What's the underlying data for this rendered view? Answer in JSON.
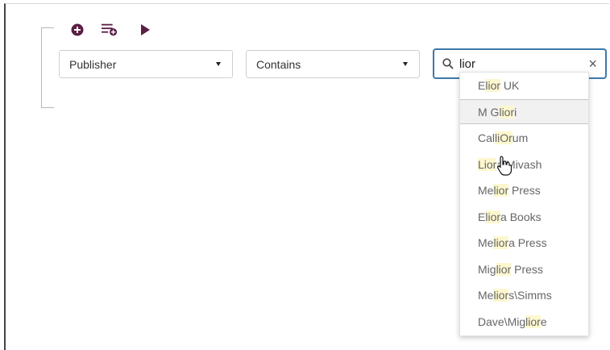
{
  "toolbar": {
    "add_icon": "plus-circle-icon",
    "add_group_icon": "list-plus-icon",
    "run_icon": "play-icon"
  },
  "filter": {
    "field": "Publisher",
    "operator": "Contains",
    "search_value": "lior",
    "clear_label": "×"
  },
  "suggestions": [
    {
      "label": "Elior UK"
    },
    {
      "label": "M Gliori"
    },
    {
      "label": "CalliOrum"
    },
    {
      "label": "Liora Mivash"
    },
    {
      "label": "Melior Press"
    },
    {
      "label": "Eliora Books"
    },
    {
      "label": "Meliora Press"
    },
    {
      "label": "Miglior Press"
    },
    {
      "label": "Meliors\\Simms"
    },
    {
      "label": "Dave\\Migliore"
    }
  ],
  "colors": {
    "icon": "#5c1f45",
    "focus_border": "#3d78a8",
    "highlight": "#fdf7cf"
  }
}
